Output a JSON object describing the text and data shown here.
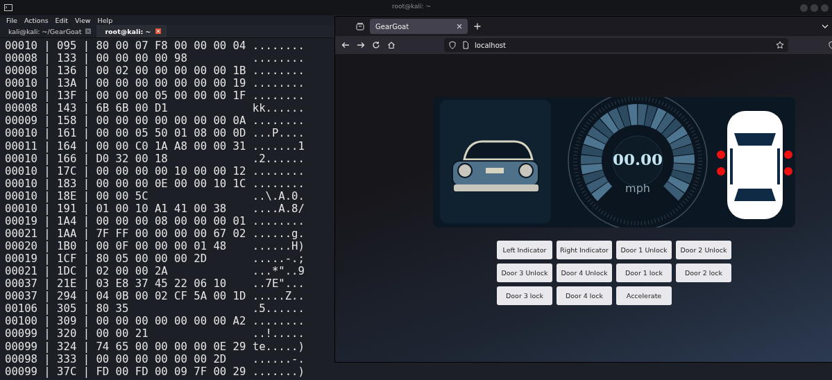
{
  "terminal": {
    "title": "root@kali: ~",
    "menu": [
      "File",
      "Actions",
      "Edit",
      "View",
      "Help"
    ],
    "tabs": [
      {
        "label": "kali@kali: ~/GearGoat",
        "selected": false
      },
      {
        "label": "root@kali: ~",
        "selected": true
      }
    ],
    "lines": [
      "00010 | 095 | 80 00 07 F8 00 00 00 04 ........",
      "00008 | 133 | 00 00 00 00 98          ........",
      "00008 | 136 | 00 02 00 00 00 00 00 1B ........",
      "00010 | 13A | 00 00 00 00 00 00 00 19 ........",
      "00010 | 13F | 00 00 00 05 00 00 00 1F ........",
      "00008 | 143 | 6B 6B 00 D1             kk......",
      "00009 | 158 | 00 00 00 00 00 00 00 0A ........",
      "00010 | 161 | 00 00 05 50 01 08 00 0D ...P....",
      "00011 | 164 | 00 00 C0 1A A8 00 00 31 .......1",
      "00010 | 166 | D0 32 00 18             .2......",
      "00010 | 17C | 00 00 00 00 10 00 00 12 ........",
      "00010 | 183 | 00 00 00 0E 00 00 10 1C ........",
      "00010 | 18E | 00 00 5C                ..\\.A.0.",
      "00010 | 191 | 01 00 10 A1 41 00 38    ....A.8/",
      "00019 | 1A4 | 00 00 00 08 00 00 00 01 ........",
      "00021 | 1AA | 7F FF 00 00 00 00 67 02 ......g.",
      "00020 | 1B0 | 00 0F 00 00 00 01 48    ......H)",
      "00019 | 1CF | 80 05 00 00 00 2D       .....-.;",
      "00021 | 1DC | 02 00 00 2A             ...*\"..9",
      "00037 | 21E | 03 E8 37 45 22 06 10    ..7E\"...",
      "00037 | 294 | 04 0B 00 02 CF 5A 00 1D .....Z..",
      "00106 | 305 | 80 35                   .5......",
      "00100 | 309 | 00 00 00 00 00 00 00 A2 ........",
      "00099 | 320 | 00 00 21                ..!.....",
      "00099 | 324 | 74 65 00 00 00 00 0E 29 te.....)",
      "00098 | 333 | 00 00 00 00 00 00 2D    ......-.",
      "00099 | 37C | FD 00 FD 00 09 7F 00 29 .......)"
    ]
  },
  "browser": {
    "tabs": [
      {
        "label": "GearGoat",
        "selected": true
      }
    ],
    "address": "localhost",
    "dashboard": {
      "speed": "00.00",
      "unit": "mph"
    },
    "buttons": [
      "Left Indicator",
      "Right Indicator",
      "Door 1 Unlock",
      "Door 2 Unlock",
      "Door 3 Unlock",
      "Door 4 Unlock",
      "Door 1 lock",
      "Door 2 lock",
      "Door 3 lock",
      "Door 4 lock",
      "Accelerate"
    ]
  }
}
